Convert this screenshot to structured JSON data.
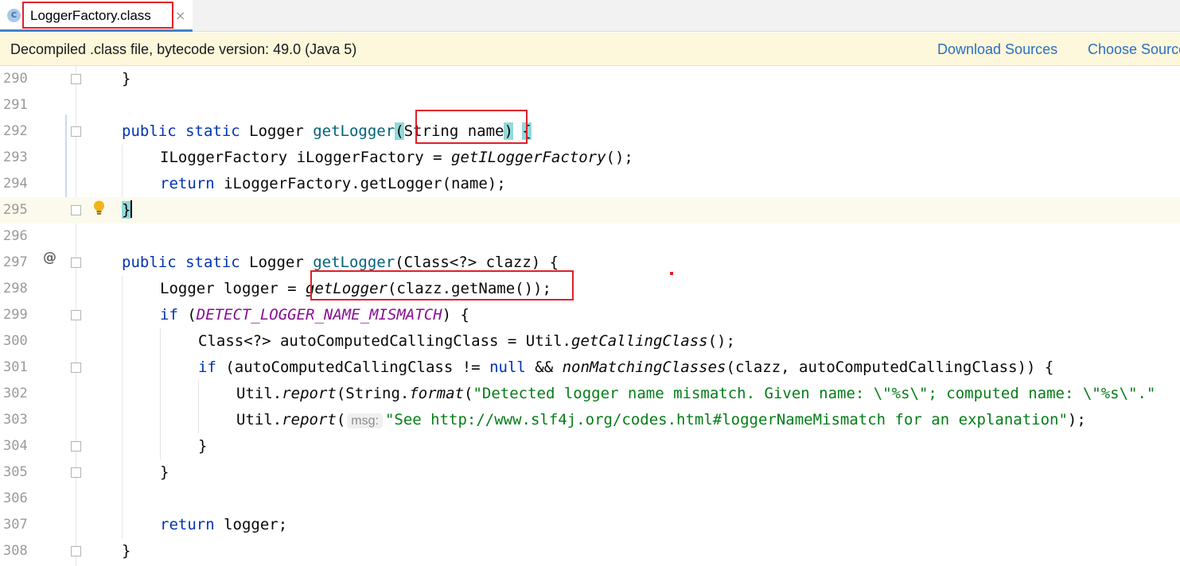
{
  "tab": {
    "label": "LoggerFactory.class",
    "close": "×",
    "file_icon": "C"
  },
  "banner": {
    "message": "Decompiled .class file, bytecode version: 49.0 (Java 5)",
    "download_sources": "Download Sources",
    "choose_sources": "Choose Sources..."
  },
  "gutter": {
    "annotation_marker": "@"
  },
  "inlay_hint": "msg:",
  "code": {
    "l290": "}",
    "l292": {
      "kw1": "public static ",
      "type": "Logger ",
      "fn": "getLogger",
      "open": "(",
      "param": "String name",
      "close": ")",
      "sp": " ",
      "brace": "{"
    },
    "l293": {
      "a": "ILoggerFactory iLoggerFactory = ",
      "b": "getILoggerFactory",
      "c": "();"
    },
    "l294": {
      "kw": "return",
      "rest": " iLoggerFactory.getLogger(name);"
    },
    "l295": "}",
    "l297": {
      "kw1": "public static ",
      "type": "Logger ",
      "fn": "getLogger",
      "rest": "(Class<?> clazz) {"
    },
    "l298": {
      "a": "Logger logger = ",
      "b": "getLogger",
      "c": "(clazz.getName());"
    },
    "l299": {
      "kw": "if",
      "a": " (",
      "b": "DETECT_LOGGER_NAME_MISMATCH",
      "c": ") {"
    },
    "l300": {
      "a": "Class<?> autoComputedCallingClass = Util.",
      "b": "getCallingClass",
      "c": "();"
    },
    "l301": {
      "kw": "if",
      "a": " (autoComputedCallingClass != ",
      "kw2": "null",
      "b": " && ",
      "c": "nonMatchingClasses",
      "d": "(clazz, autoComputedCallingClass)) {"
    },
    "l302": {
      "a": "Util.",
      "b": "report",
      "c": "(String.",
      "d": "format",
      "e": "(",
      "s": "\"Detected logger name mismatch. Given name: \\\"%s\\\"; computed name: \\\"%s\\\".\""
    },
    "l303": {
      "a": "Util.",
      "b": "report",
      "c": "(",
      "s": "\"See http://www.slf4j.org/codes.html#loggerNameMismatch for an explanation\"",
      "d": ");"
    },
    "l304": "}",
    "l305": "}",
    "l307": {
      "kw": "return",
      "rest": " logger;"
    },
    "l308": "}"
  },
  "line_numbers": [
    "290",
    "291",
    "292",
    "293",
    "294",
    "295",
    "296",
    "297",
    "298",
    "299",
    "300",
    "301",
    "302",
    "303",
    "304",
    "305",
    "306",
    "307",
    "308"
  ]
}
